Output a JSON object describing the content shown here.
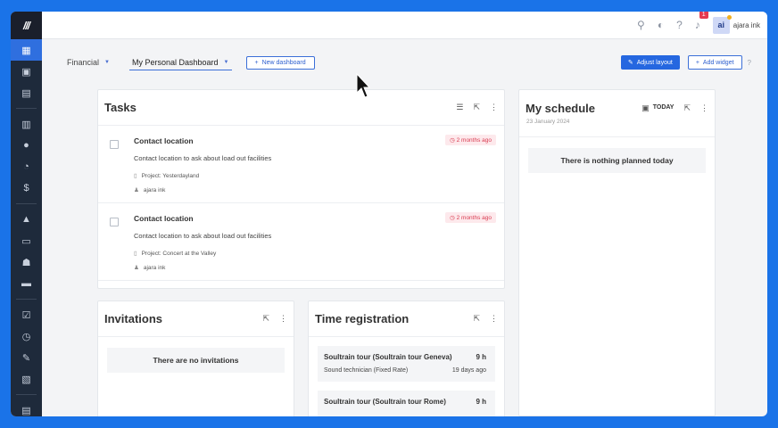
{
  "app": {
    "logo_text": "///"
  },
  "rail": {
    "icons": [
      "dashboard-icon",
      "calendar-icon",
      "calendar-add-icon",
      "table-icon",
      "person-icon",
      "chart-icon",
      "dollar-icon",
      "shapes-icon",
      "id-card-icon",
      "group-icon",
      "truck-icon",
      "checklist-icon",
      "clock-icon",
      "wrench-icon",
      "report-icon",
      "chat-icon",
      "chevron-down-icon"
    ]
  },
  "topbar": {
    "notification_count": "1",
    "avatar_initials": "ai",
    "username": "ajara ink"
  },
  "toolbar": {
    "dashboard_select": "Financial",
    "active_dashboard": "My Personal Dashboard",
    "new_dashboard_label": "New dashboard",
    "adjust_layout_label": "Adjust layout",
    "add_widget_label": "Add widget"
  },
  "tasks": {
    "title": "Tasks",
    "items": [
      {
        "title": "Contact location",
        "description": "Contact location to ask about load out facilities",
        "project": "Project: Yesterdayland",
        "user": "ajara ink",
        "due": "2 months ago"
      },
      {
        "title": "Contact location",
        "description": "Contact location to ask about load out facilities",
        "project": "Project: Concert at the Valley",
        "user": "ajara ink",
        "due": "2 months ago"
      }
    ]
  },
  "schedule": {
    "title": "My schedule",
    "today_label": "TODAY",
    "date": "23 January 2024",
    "empty_text": "There is nothing planned today"
  },
  "invitations": {
    "title": "Invitations",
    "empty_text": "There are no invitations"
  },
  "time_registration": {
    "title": "Time registration",
    "entries": [
      {
        "name": "Soultrain tour (Soultrain tour Geneva)",
        "hours": "9 h",
        "role": "Sound technician (Fixed Rate)",
        "ago": "19 days ago"
      },
      {
        "name": "Soultrain tour (Soultrain tour Rome)",
        "hours": "9 h"
      }
    ]
  },
  "colors": {
    "accent": "#2567e0",
    "rail": "#1e2a3b",
    "due_red": "#d93b50",
    "outer": "#1a73e8"
  }
}
